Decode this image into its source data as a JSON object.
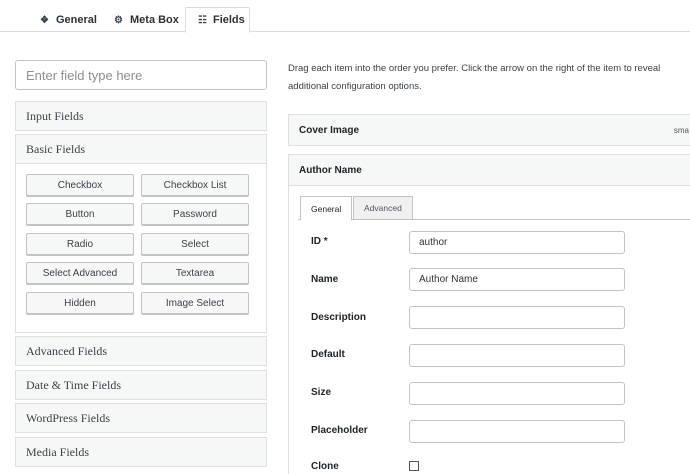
{
  "top_tabs": [
    {
      "label": "General",
      "icon": "info-icon"
    },
    {
      "label": "Meta Box",
      "icon": "gear-icon"
    },
    {
      "label": "Fields",
      "icon": "list-icon"
    }
  ],
  "search": {
    "placeholder": "Enter field type here"
  },
  "groups": {
    "input": "Input Fields",
    "basic": "Basic Fields",
    "advanced": "Advanced Fields",
    "datetime": "Date & Time Fields",
    "wordpress": "WordPress Fields",
    "media": "Media Fields"
  },
  "basic_buttons": [
    "Checkbox",
    "Checkbox List",
    "Button",
    "Password",
    "Radio",
    "Select",
    "Select Advanced",
    "Textarea",
    "Hidden",
    "Image Select"
  ],
  "instructions": "Drag each item into the order you prefer. Click the arrow on the right of the item to reveal additional configuration options.",
  "fields": {
    "cover": {
      "title": "Cover Image",
      "type_hint": "sma"
    },
    "author": {
      "title": "Author Name"
    }
  },
  "inner_tabs": {
    "general": "General",
    "advanced": "Advanced"
  },
  "form": {
    "id": {
      "label": "ID *",
      "value": "author"
    },
    "name": {
      "label": "Name",
      "value": "Author Name"
    },
    "description": {
      "label": "Description",
      "value": ""
    },
    "default": {
      "label": "Default",
      "value": ""
    },
    "size": {
      "label": "Size",
      "value": ""
    },
    "placeholder": {
      "label": "Placeholder",
      "value": ""
    },
    "clone": {
      "label": "Clone",
      "checked": false
    }
  }
}
